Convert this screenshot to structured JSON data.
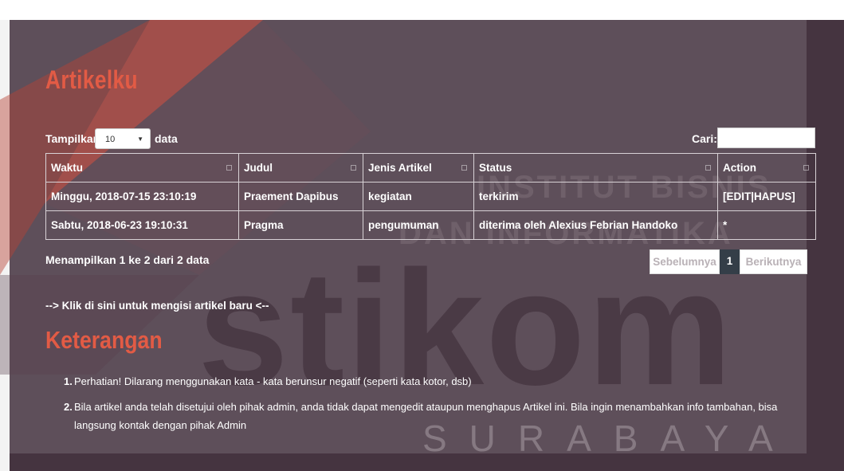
{
  "page": {
    "title": "Artikelku",
    "show_label": "Tampilkan",
    "page_length": "10",
    "data_label": "data",
    "search_label": "Cari:",
    "search_value": ""
  },
  "table": {
    "columns": [
      "Waktu",
      "Judul",
      "Jenis Artikel",
      "Status",
      "Action"
    ],
    "rows": [
      [
        "Minggu, 2018-07-15 23:10:19",
        "Praement Dapibus",
        "kegiatan",
        "terkirim",
        "[EDIT|HAPUS]"
      ],
      [
        "Sabtu, 2018-06-23 19:10:31",
        "Pragma",
        "pengumuman",
        "diterima oleh Alexius Febrian Handoko",
        "*"
      ]
    ]
  },
  "footer": {
    "info": "Menampilkan 1 ke 2 dari 2 data",
    "prev": "Sebelumnya",
    "current_page": "1",
    "next": "Berikutnya"
  },
  "new_article_link": "--> Klik di sini untuk mengisi artikel baru <--",
  "notes": {
    "title": "Keterangan",
    "items": [
      {
        "num": "1.",
        "text": "Perhatian! Dilarang menggunakan kata - kata berunsur negatif (seperti kata kotor, dsb)"
      },
      {
        "num": "2.",
        "text": "Bila artikel anda telah disetujui oleh pihak admin, anda tidak dapat mengedit ataupun menghapus Artikel ini. Bila ingin menambahkan info tambahan, bisa langsung kontak dengan pihak Admin"
      }
    ]
  },
  "watermark": {
    "line1": "INSTITUT BISNIS",
    "line2": "DAN INFORMATIKA",
    "brand": "stikom",
    "city": "SURABAYA"
  },
  "colors": {
    "panel": "#5e4f5a",
    "accent": "#e25b45",
    "pager_active": "#343e48"
  }
}
